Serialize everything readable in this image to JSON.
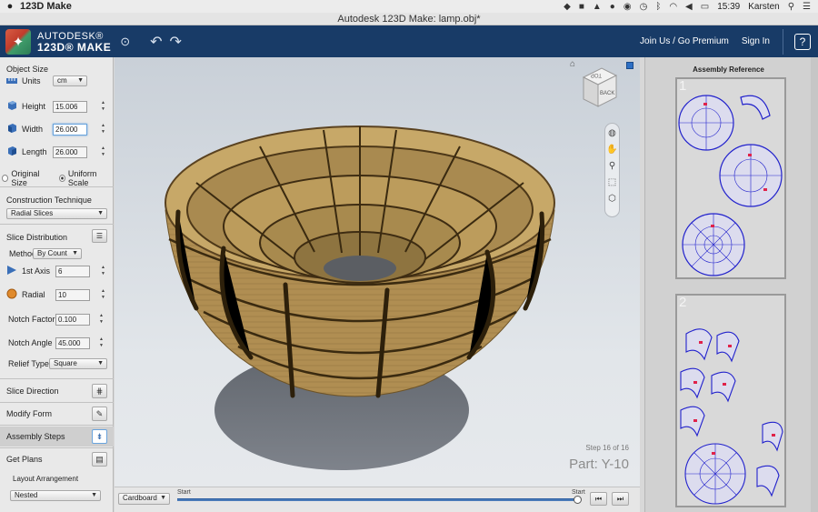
{
  "menubar": {
    "apple": "",
    "app_name": "123D Make",
    "items": [],
    "user": "Karsten",
    "clock": "15:39",
    "battery": "",
    "status_icons": [
      "dropbox-icon",
      "wifi-icon",
      "bluetooth-icon",
      "volume-icon"
    ]
  },
  "window": {
    "title": "Autodesk 123D Make: lamp.obj*"
  },
  "header": {
    "logo_line1": "AUTODESK®",
    "logo_line2": "123D® MAKE",
    "join_label": "Join Us / Go Premium",
    "sign_in_label": "Sign In",
    "help_label": "?"
  },
  "left_panel": {
    "object_size": {
      "title": "Object Size",
      "units_label": "Units",
      "units_value": "cm",
      "height_label": "Height",
      "height_value": "15.006",
      "width_label": "Width",
      "width_value": "26.000",
      "length_label": "Length",
      "length_value": "26.000",
      "original_size_label": "Original Size",
      "uniform_scale_label": "Uniform Scale"
    },
    "construction": {
      "title": "Construction Technique",
      "value": "Radial Slices"
    },
    "slice_distribution": {
      "title": "Slice Distribution",
      "method_label": "Method",
      "method_value": "By Count",
      "axis_label": "1st Axis",
      "axis_value": "6",
      "radial_label": "Radial",
      "radial_value": "10",
      "notch_factor_label": "Notch Factor",
      "notch_factor_value": "0.100",
      "notch_angle_label": "Notch Angle",
      "notch_angle_value": "45.000",
      "relief_label": "Relief Type",
      "relief_value": "Square"
    },
    "buttons": {
      "slice_direction": "Slice Direction",
      "modify_form": "Modify Form",
      "assembly_steps": "Assembly Steps",
      "get_plans": "Get Plans"
    },
    "layout": {
      "label": "Layout Arrangement",
      "value": "Nested"
    }
  },
  "viewport": {
    "viewcube_label": "BACK",
    "viewcube_top": "TOP",
    "step_text": "Step 16 of 16",
    "part_text": "Part: Y-10",
    "model_color": "#b59558",
    "background_color": "#d5dbe2"
  },
  "bottom_bar": {
    "material": "Cardboard",
    "start_label": "Start",
    "end_label": "Start",
    "progress": 1.0
  },
  "right_panel": {
    "title": "Assembly Reference",
    "sheets": [
      {
        "number": "1"
      },
      {
        "number": "2"
      }
    ],
    "piece_color": "#2222cc"
  }
}
